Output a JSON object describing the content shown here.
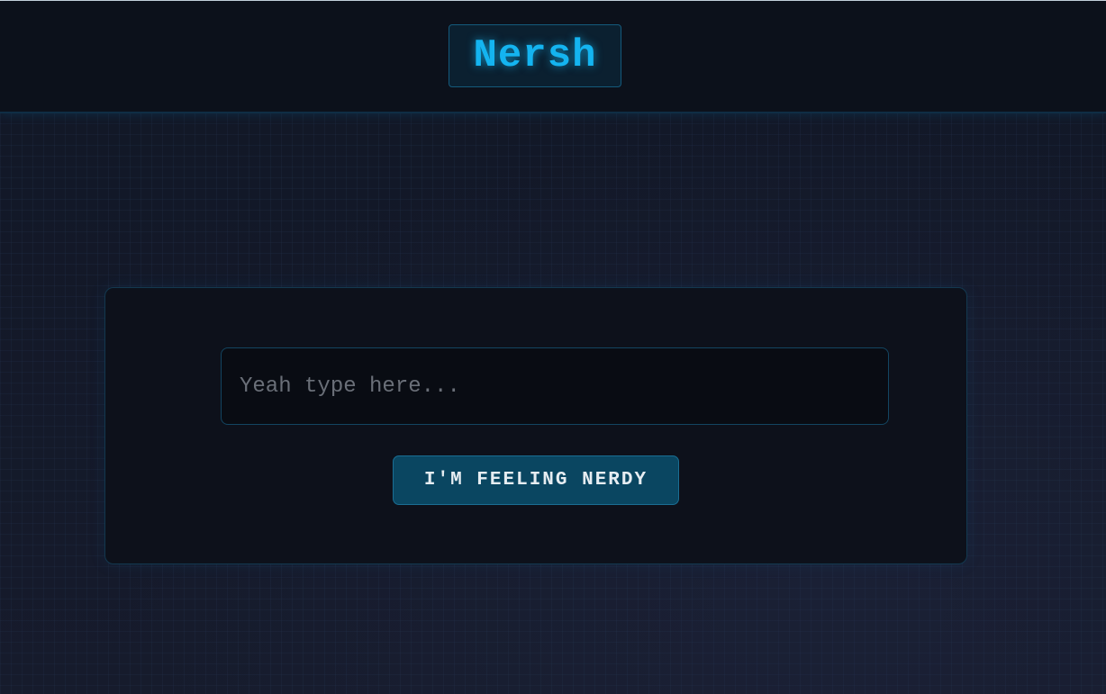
{
  "header": {
    "logo_text": "Nersh"
  },
  "search": {
    "value": "",
    "placeholder": "Yeah type here..."
  },
  "actions": {
    "feeling_nerdy_label": "I'M FEELING NERDY"
  },
  "colors": {
    "accent": "#14b4f0",
    "button_bg": "#0a4661",
    "header_bg": "#0c111b",
    "page_bg": "#141a2a",
    "card_bg": "#0d111b"
  }
}
